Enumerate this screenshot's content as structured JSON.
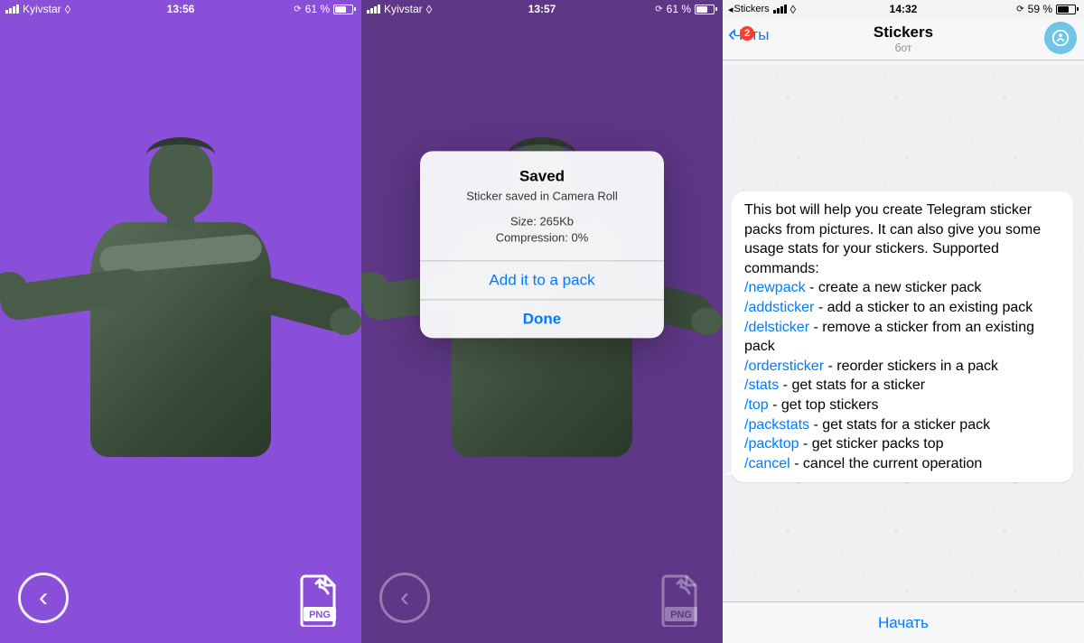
{
  "screen1": {
    "status": {
      "carrier": "Kyivstar",
      "time": "13:56",
      "battery_pct": "61 %"
    },
    "png_label": "PNG"
  },
  "screen2": {
    "status": {
      "carrier": "Kyivstar",
      "time": "13:57",
      "battery_pct": "61 %"
    },
    "alert": {
      "title": "Saved",
      "subtitle": "Sticker saved in Camera Roll",
      "size_line": "Size: 265Kb",
      "compression_line": "Compression: 0%",
      "add_btn": "Add it to a pack",
      "done_btn": "Done"
    },
    "png_label": "PNG"
  },
  "screen3": {
    "status": {
      "breadcrumb": "Stickers",
      "time": "14:32",
      "battery_pct": "59 %"
    },
    "header": {
      "back_label": "Чаты",
      "badge": "2",
      "title": "Stickers",
      "subtitle": "бот"
    },
    "message": {
      "intro": "This bot will help you create Telegram sticker packs from pictures. It can also give you some usage stats for your stickers. Supported commands:",
      "commands": [
        {
          "cmd": "/newpack",
          "desc": " - create a new sticker pack"
        },
        {
          "cmd": "/addsticker",
          "desc": " - add a sticker to an existing pack"
        },
        {
          "cmd": "/delsticker",
          "desc": " - remove a sticker from an existing pack"
        },
        {
          "cmd": "/ordersticker",
          "desc": " - reorder stickers in a pack"
        },
        {
          "cmd": "/stats",
          "desc": " - get stats for a sticker"
        },
        {
          "cmd": "/top",
          "desc": " - get top stickers"
        },
        {
          "cmd": "/packstats",
          "desc": " - get stats for a sticker pack"
        },
        {
          "cmd": "/packtop",
          "desc": " - get sticker packs top"
        },
        {
          "cmd": "/cancel",
          "desc": " - cancel the current operation"
        }
      ]
    },
    "footer_btn": "Начать"
  }
}
